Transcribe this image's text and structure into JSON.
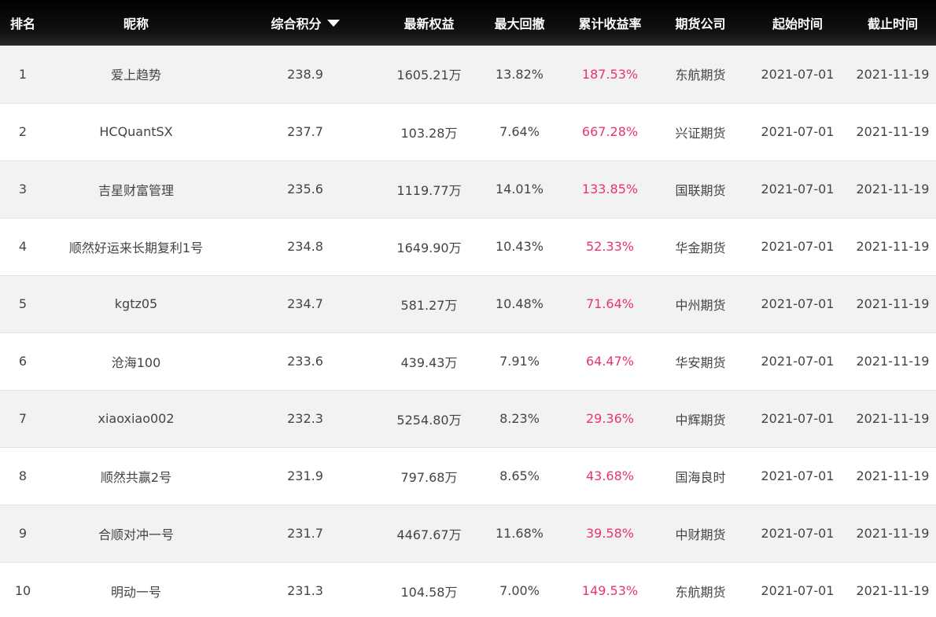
{
  "table": {
    "headers": {
      "rank": "排名",
      "nickname": "昵称",
      "score": "综合积分",
      "equity": "最新权益",
      "drawdown": "最大回撤",
      "return": "累计收益率",
      "company": "期货公司",
      "start": "起始时间",
      "end": "截止时间"
    },
    "sort_icon": "sort-desc-icon",
    "return_color": "#e8356f",
    "rows": [
      {
        "rank": "1",
        "nickname": "爱上趋势",
        "score": "238.9",
        "equity": "1605.21万",
        "drawdown": "13.82%",
        "return": "187.53%",
        "company": "东航期货",
        "start": "2021-07-01",
        "end": "2021-11-19"
      },
      {
        "rank": "2",
        "nickname": "HCQuantSX",
        "score": "237.7",
        "equity": "103.28万",
        "drawdown": "7.64%",
        "return": "667.28%",
        "company": "兴证期货",
        "start": "2021-07-01",
        "end": "2021-11-19"
      },
      {
        "rank": "3",
        "nickname": "吉星财富管理",
        "score": "235.6",
        "equity": "1119.77万",
        "drawdown": "14.01%",
        "return": "133.85%",
        "company": "国联期货",
        "start": "2021-07-01",
        "end": "2021-11-19"
      },
      {
        "rank": "4",
        "nickname": "顺然好运来长期复利1号",
        "score": "234.8",
        "equity": "1649.90万",
        "drawdown": "10.43%",
        "return": "52.33%",
        "company": "华金期货",
        "start": "2021-07-01",
        "end": "2021-11-19"
      },
      {
        "rank": "5",
        "nickname": "kgtz05",
        "score": "234.7",
        "equity": "581.27万",
        "drawdown": "10.48%",
        "return": "71.64%",
        "company": "中州期货",
        "start": "2021-07-01",
        "end": "2021-11-19"
      },
      {
        "rank": "6",
        "nickname": "沧海100",
        "score": "233.6",
        "equity": "439.43万",
        "drawdown": "7.91%",
        "return": "64.47%",
        "company": "华安期货",
        "start": "2021-07-01",
        "end": "2021-11-19"
      },
      {
        "rank": "7",
        "nickname": "xiaoxiao002",
        "score": "232.3",
        "equity": "5254.80万",
        "drawdown": "8.23%",
        "return": "29.36%",
        "company": "中辉期货",
        "start": "2021-07-01",
        "end": "2021-11-19"
      },
      {
        "rank": "8",
        "nickname": "顺然共赢2号",
        "score": "231.9",
        "equity": "797.68万",
        "drawdown": "8.65%",
        "return": "43.68%",
        "company": "国海良时",
        "start": "2021-07-01",
        "end": "2021-11-19"
      },
      {
        "rank": "9",
        "nickname": "合顺对冲一号",
        "score": "231.7",
        "equity": "4467.67万",
        "drawdown": "11.68%",
        "return": "39.58%",
        "company": "中财期货",
        "start": "2021-07-01",
        "end": "2021-11-19"
      },
      {
        "rank": "10",
        "nickname": "明动一号",
        "score": "231.3",
        "equity": "104.58万",
        "drawdown": "7.00%",
        "return": "149.53%",
        "company": "东航期货",
        "start": "2021-07-01",
        "end": "2021-11-19"
      }
    ]
  }
}
